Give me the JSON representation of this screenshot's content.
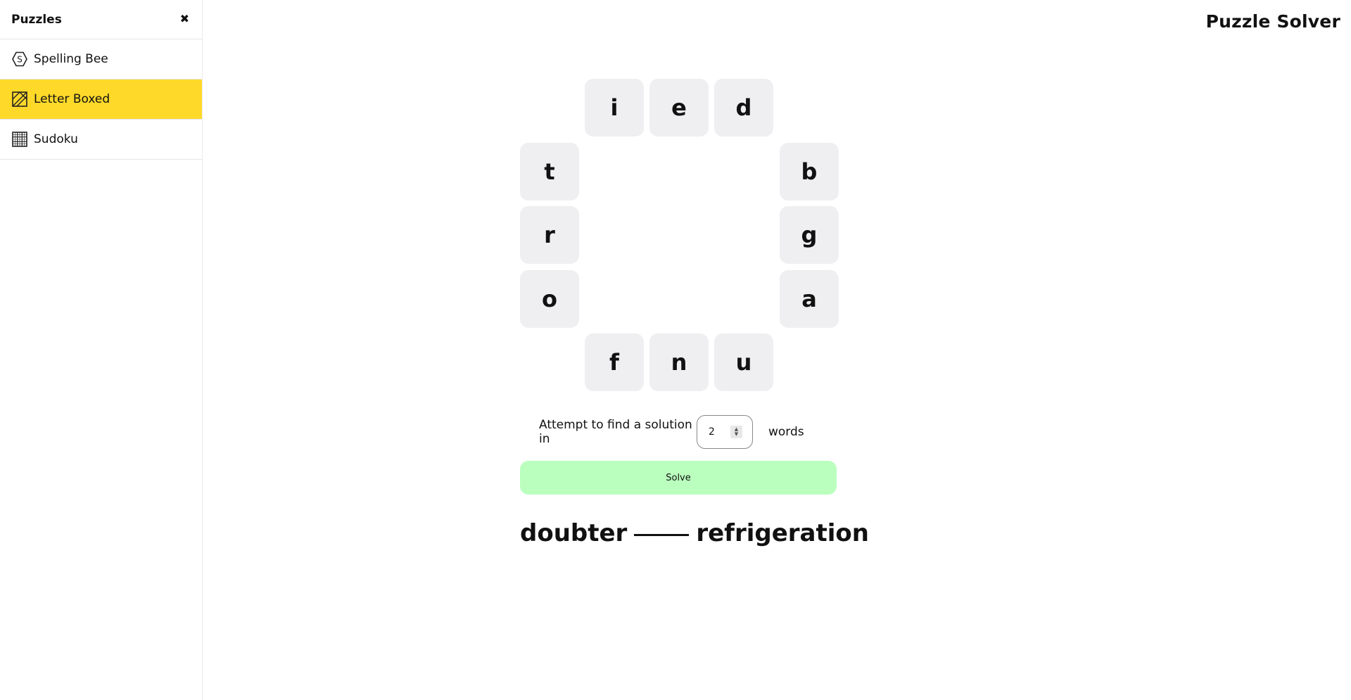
{
  "sidebar": {
    "title": "Puzzles",
    "close_symbol": "✖",
    "items": [
      {
        "label": "Spelling Bee",
        "icon": "hexagon-s-icon",
        "active": false
      },
      {
        "label": "Letter Boxed",
        "icon": "letter-box-icon",
        "active": true
      },
      {
        "label": "Sudoku",
        "icon": "grid-icon",
        "active": false
      }
    ]
  },
  "header": {
    "app_title": "Puzzle Solver"
  },
  "board": {
    "top": [
      "i",
      "e",
      "d"
    ],
    "left": [
      "t",
      "r",
      "o"
    ],
    "right": [
      "b",
      "g",
      "a"
    ],
    "bottom": [
      "f",
      "n",
      "u"
    ]
  },
  "controls": {
    "attempt_label": "Attempt to find a solution in",
    "word_count": "2",
    "words_label": "words",
    "solve_label": "Solve"
  },
  "result": {
    "words": [
      "doubter",
      "refrigeration"
    ]
  },
  "colors": {
    "active_item": "#ffd92a",
    "tile_bg": "#efeff2",
    "solve_bg": "#baffbe"
  }
}
